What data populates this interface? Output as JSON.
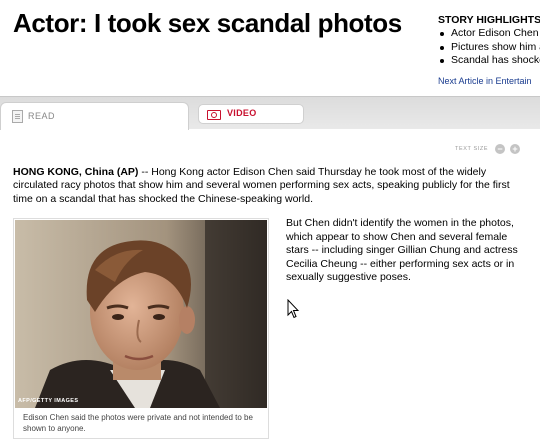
{
  "headline": "Actor: I took sex scandal photos",
  "highlights": {
    "title": "STORY HIGHLIGHTS",
    "items": [
      "Actor Edison Chen sa",
      "Pictures show him ar",
      "Scandal has shocked"
    ],
    "next_link": "Next Article in Entertain"
  },
  "tabs": {
    "read": "READ",
    "video": "VIDEO"
  },
  "text_size": {
    "label": "TEXT SIZE",
    "minus": "−",
    "plus": "+"
  },
  "article": {
    "dateline": "HONG KONG, China (AP)",
    "lead": " -- Hong Kong actor Edison Chen said Thursday he took most of the widely circulated racy photos that show him and several women performing sex acts, speaking publicly for the first time on a scandal that has shocked the Chinese-speaking world.",
    "para2": "But Chen didn't identify the women in the photos, which appear to show Chen and several female stars -- including singer Gillian Chung and actress Cecilia Cheung -- either performing sex acts or in sexually suggestive poses."
  },
  "photo": {
    "credit": "AFP/GETTY IMAGES",
    "caption": "Edison Chen said the photos were private and not intended to be shown to anyone."
  },
  "icons": [
    "document-icon",
    "video-camera-icon",
    "mouse-cursor-icon"
  ]
}
